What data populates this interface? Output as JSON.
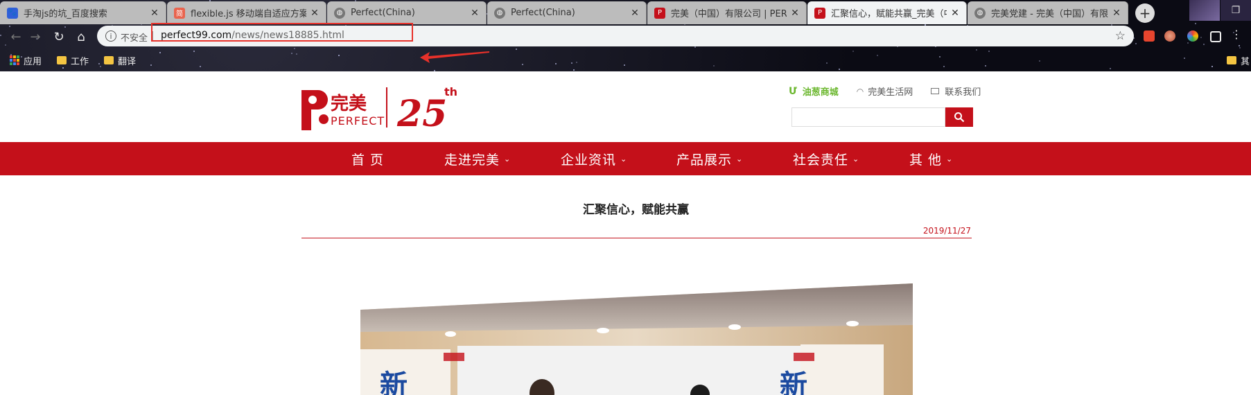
{
  "browser": {
    "tabs": [
      {
        "title": "手淘js的坑_百度搜索",
        "favicon": "baidu-icon",
        "active": false
      },
      {
        "title": "flexible.js 移动端自适应方案 -",
        "favicon": "jianshu-icon",
        "active": false
      },
      {
        "title": "Perfect(China)",
        "favicon": "globe-icon",
        "active": false
      },
      {
        "title": "Perfect(China)",
        "favicon": "globe-icon",
        "active": false
      },
      {
        "title": "完美（中国）有限公司 | PERFE",
        "favicon": "perfect-icon",
        "active": false
      },
      {
        "title": "汇聚信心，赋能共赢_完美（中",
        "favicon": "perfect-icon",
        "active": true
      },
      {
        "title": "完美党建 - 完美（中国）有限公",
        "favicon": "globe-icon",
        "active": false
      }
    ],
    "address": {
      "insecure_label": "不安全",
      "url_host": "perfect99.com",
      "url_path": "/news/news18885.html"
    },
    "bookmarks": [
      {
        "label": "应用",
        "icon": "apps-grid-icon"
      },
      {
        "label": "工作",
        "icon": "folder-icon"
      },
      {
        "label": "翻译",
        "icon": "folder-icon"
      }
    ],
    "bookmarks_overflow": "其",
    "annotation_color": "#e8312a"
  },
  "site": {
    "brand_color": "#c4101a",
    "logo": {
      "text_cn": "完美",
      "text_en": "PERFECT",
      "anniversary": "25",
      "suffix": "th"
    },
    "top_links": [
      {
        "label": "油葱商城",
        "icon": "shop-icon"
      },
      {
        "label": "完美生活网",
        "icon": "wifi-icon"
      },
      {
        "label": "联系我们",
        "icon": "mail-icon"
      }
    ],
    "search": {
      "placeholder": ""
    },
    "nav": [
      {
        "label": "首 页",
        "has_dropdown": false
      },
      {
        "label": "走进完美",
        "has_dropdown": true
      },
      {
        "label": "企业资讯",
        "has_dropdown": true
      },
      {
        "label": "产品展示",
        "has_dropdown": true
      },
      {
        "label": "社会责任",
        "has_dropdown": true
      },
      {
        "label": "其 他",
        "has_dropdown": true
      }
    ],
    "caret": "⌄",
    "article": {
      "title": "汇聚信心，赋能共赢",
      "date": "2019/11/27"
    },
    "photo": {
      "banner_text": "新"
    }
  }
}
